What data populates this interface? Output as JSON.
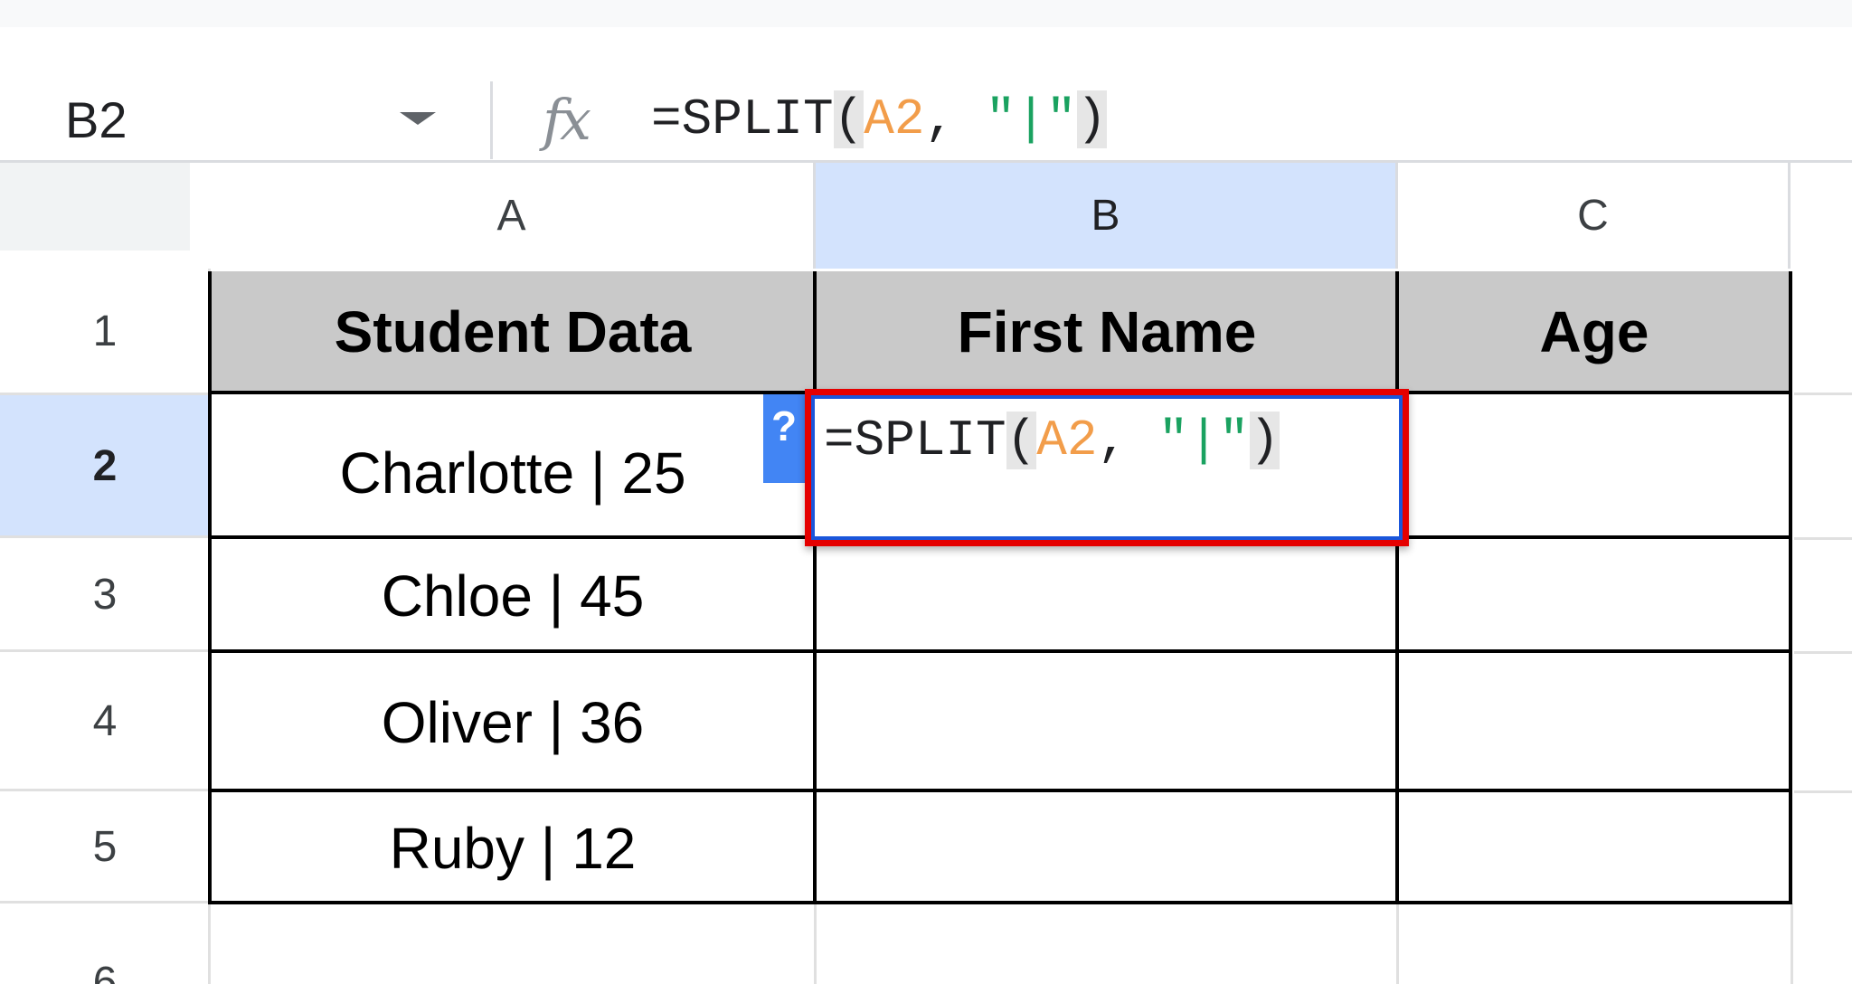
{
  "formula_bar": {
    "cell_ref": "B2",
    "fx_label": "fx",
    "formula": {
      "prefix": "=SPLIT",
      "open_paren": "(",
      "ref": "A2",
      "sep": ", ",
      "quote_open": "\"",
      "delimiter": "|",
      "quote_close": "\"",
      "close_paren": ")"
    }
  },
  "columns": [
    "A",
    "B",
    "C"
  ],
  "rows": [
    "1",
    "2",
    "3",
    "4",
    "5",
    "6"
  ],
  "headers": [
    "Student Data",
    "First Name",
    "Age"
  ],
  "data": [
    "Charlotte | 25",
    "Chloe | 45",
    "Oliver | 36",
    "Ruby | 12"
  ],
  "active_cell": {
    "ref": "B2",
    "help_glyph": "?"
  },
  "colors": {
    "selection": "#d3e3fd",
    "header_fill": "#c9c9c9",
    "highlight_border": "#e50000",
    "cell_ref": "#f29d4a",
    "string_literal": "#1aa260"
  }
}
